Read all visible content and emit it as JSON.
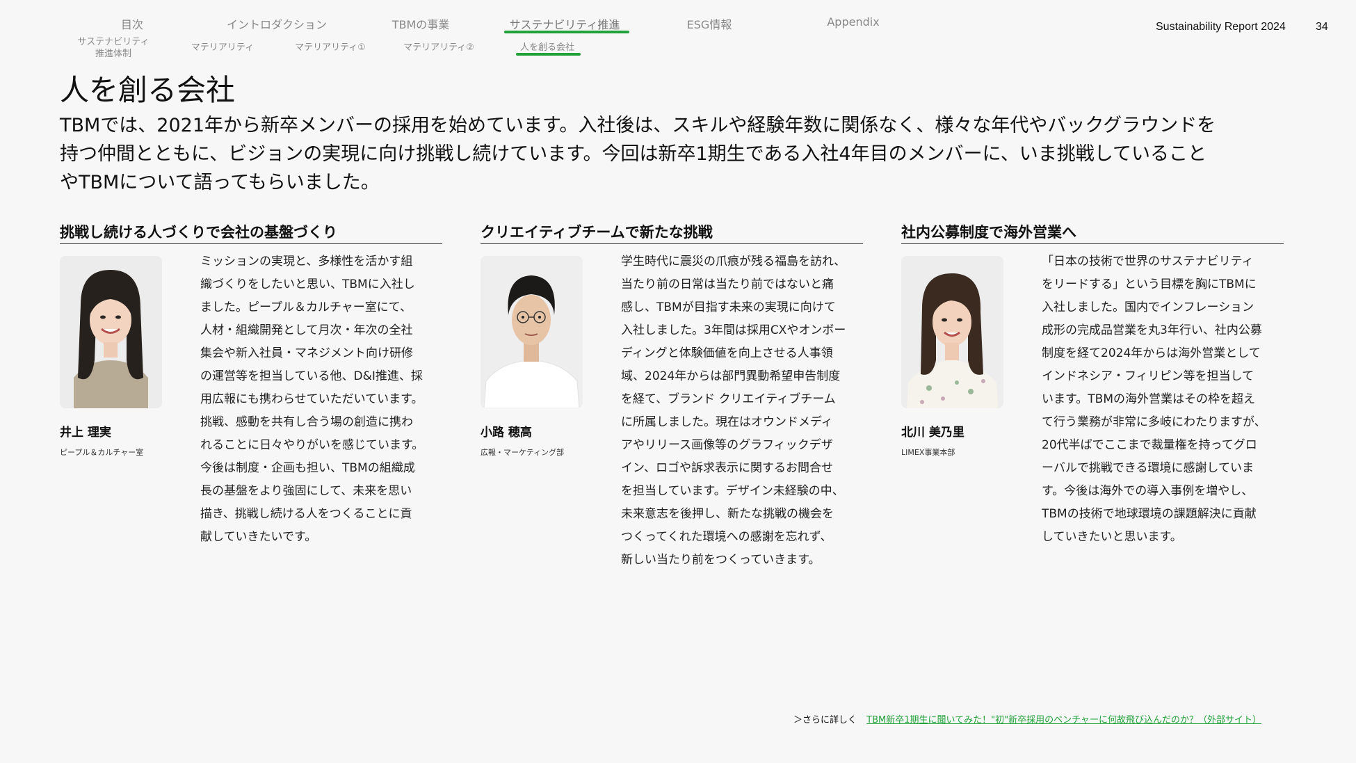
{
  "nav": {
    "items": [
      {
        "label": "目次"
      },
      {
        "label": "イントロダクション"
      },
      {
        "label": "TBMの事業"
      },
      {
        "label": "サステナビリティ推進"
      },
      {
        "label": "ESG情報"
      },
      {
        "label": "Appendix"
      }
    ],
    "active_index": 3,
    "accent_color": "#22a23a"
  },
  "subnav": {
    "items": [
      {
        "label_line1": "サステナビリティ",
        "label_line2": "推進体制"
      },
      {
        "label_line1": "マテリアリティ"
      },
      {
        "label_line1": "マテリアリティ①"
      },
      {
        "label_line1": "マテリアリティ②"
      },
      {
        "label_line1": "人を創る会社"
      }
    ],
    "active_index": 4
  },
  "header": {
    "report_title": "Sustainability Report 2024",
    "page_number": "34"
  },
  "page": {
    "title": "人を創る会社",
    "intro_lines": [
      "TBMでは、2021年から新卒メンバーの採用を始めています。入社後は、スキルや経験年数に関係なく、様々な年代やバックグラウンドを",
      "持つ仲間とともに、ビジョンの実現に向け挑戦し続けています。今回は新卒1期生である入社4年目のメンバーに、いま挑戦していること",
      "やTBMについて語ってもらいました。"
    ]
  },
  "columns": [
    {
      "heading": "挑戦し続ける人づくりで会社の基盤づくり",
      "name": "井上 理実",
      "department": "ピープル＆カルチャー室",
      "photo_icon": "portrait-photo",
      "lines": [
        "ミッションの実現と、多様性を活かす組",
        "織づくりをしたいと思い、TBMに入社し",
        "ました。ピープル＆カルチャー室にて、",
        "人材・組織開発として月次・年次の全社",
        "集会や新入社員・マネジメント向け研修",
        "の運営等を担当している他、D&I推進、採",
        "用広報にも携わらせていただいています。",
        "挑戦、感動を共有し合う場の創造に携わ",
        "れることに日々やりがいを感じています。",
        "今後は制度・企画も担い、TBMの組織成",
        "長の基盤をより強固にして、未来を思い",
        "描き、挑戦し続ける人をつくることに貢",
        "献していきたいです。"
      ]
    },
    {
      "heading": "クリエイティブチームで新たな挑戦",
      "name": "小路 穂高",
      "department": "広報・マーケティング部",
      "photo_icon": "portrait-photo",
      "lines": [
        "学生時代に震災の爪痕が残る福島を訪れ、",
        "当たり前の日常は当たり前ではないと痛",
        "感し、TBMが目指す未来の実現に向けて",
        "入社しました。3年間は採用CXやオンボー",
        "ディングと体験価値を向上させる人事領",
        "域、2024年からは部門異動希望申告制度",
        "を経て、ブランド クリエイティブチーム",
        "に所属しました。現在はオウンドメディ",
        "アやリリース画像等のグラフィックデザ",
        "イン、ロゴや訴求表示に関するお問合せ",
        "を担当しています。デザイン未経験の中、",
        "未来意志を後押し、新たな挑戦の機会を",
        "つくってくれた環境への感謝を忘れず、",
        "新しい当たり前をつくっていきます。"
      ]
    },
    {
      "heading": "社内公募制度で海外営業へ",
      "name": "北川 美乃里",
      "department": "LIMEX事業本部",
      "photo_icon": "portrait-photo",
      "lines": [
        "「日本の技術で世界のサステナビリティ",
        "をリードする」という目標を胸にTBMに",
        "入社しました。国内でインフレーション",
        "成形の完成品営業を丸3年行い、社内公募",
        "制度を経て2024年からは海外営業として",
        "インドネシア・フィリピン等を担当して",
        "います。TBMの海外営業はその枠を超え",
        "て行う業務が非常に多岐にわたりますが、",
        "20代半ばでここまで裁量権を持ってグロ",
        "ーバルで挑戦できる環境に感謝していま",
        "す。今後は海外での導入事例を増やし、",
        "TBMの技術で地球環境の課題解決に貢献",
        "していきたいと思います。"
      ]
    }
  ],
  "footer": {
    "prefix": "＞さらに詳しく",
    "link_text": "TBM新卒1期生に聞いてみた！\"初\"新卒採用のベンチャーに何故飛び込んだのか？（外部サイト）"
  }
}
